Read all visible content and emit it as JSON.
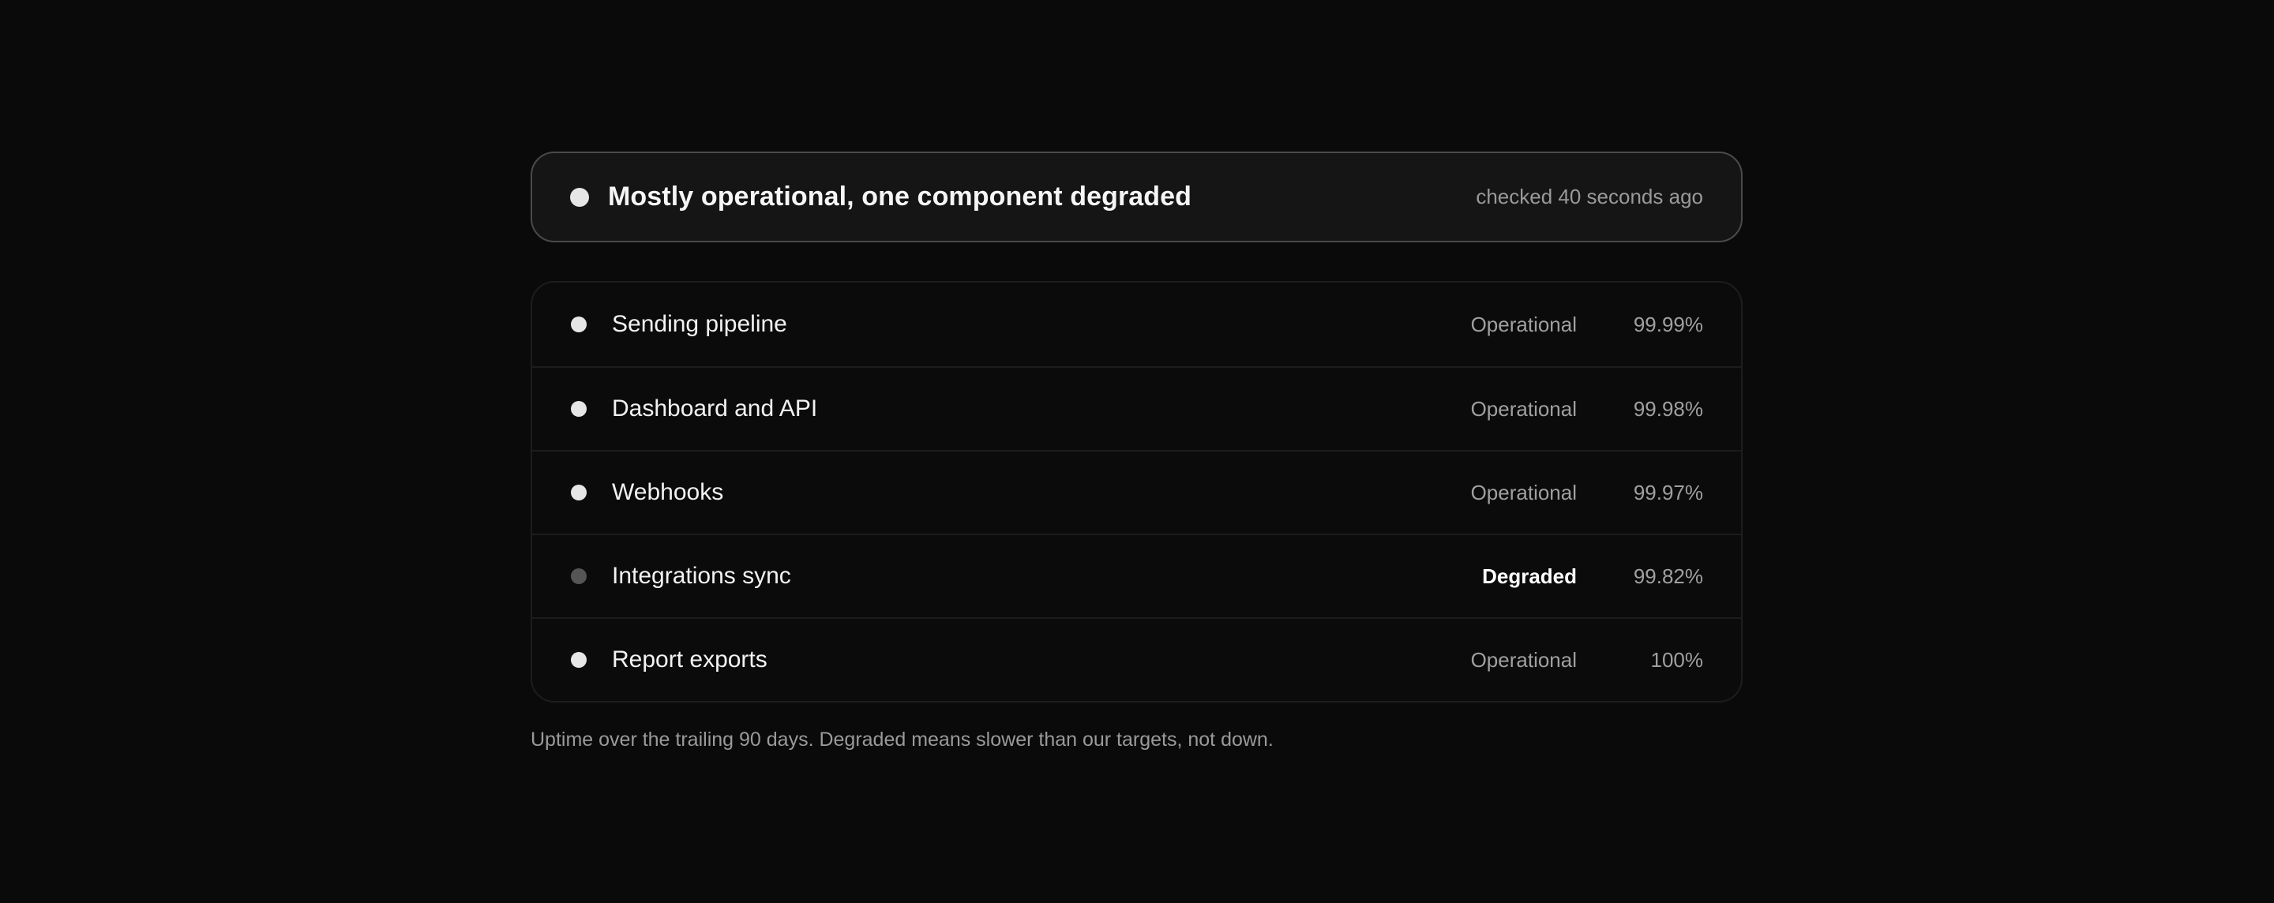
{
  "summary": {
    "title": "Mostly operational, one component degraded",
    "checked": "checked 40 seconds ago"
  },
  "components": [
    {
      "name": "Sending pipeline",
      "status": "Operational",
      "uptime": "99.99%"
    },
    {
      "name": "Dashboard and API",
      "status": "Operational",
      "uptime": "99.98%"
    },
    {
      "name": "Webhooks",
      "status": "Operational",
      "uptime": "99.97%"
    },
    {
      "name": "Integrations sync",
      "status": "Degraded",
      "uptime": "99.82%"
    },
    {
      "name": "Report exports",
      "status": "Operational",
      "uptime": "100%"
    }
  ],
  "footnote": "Uptime over the trailing 90 days. Degraded means slower than our targets, not down.",
  "colors": {
    "background": "#0a0a0a",
    "operational_dot": "#e6e6e6",
    "degraded_dot": "#555555",
    "muted_text": "#a0a0a0"
  }
}
